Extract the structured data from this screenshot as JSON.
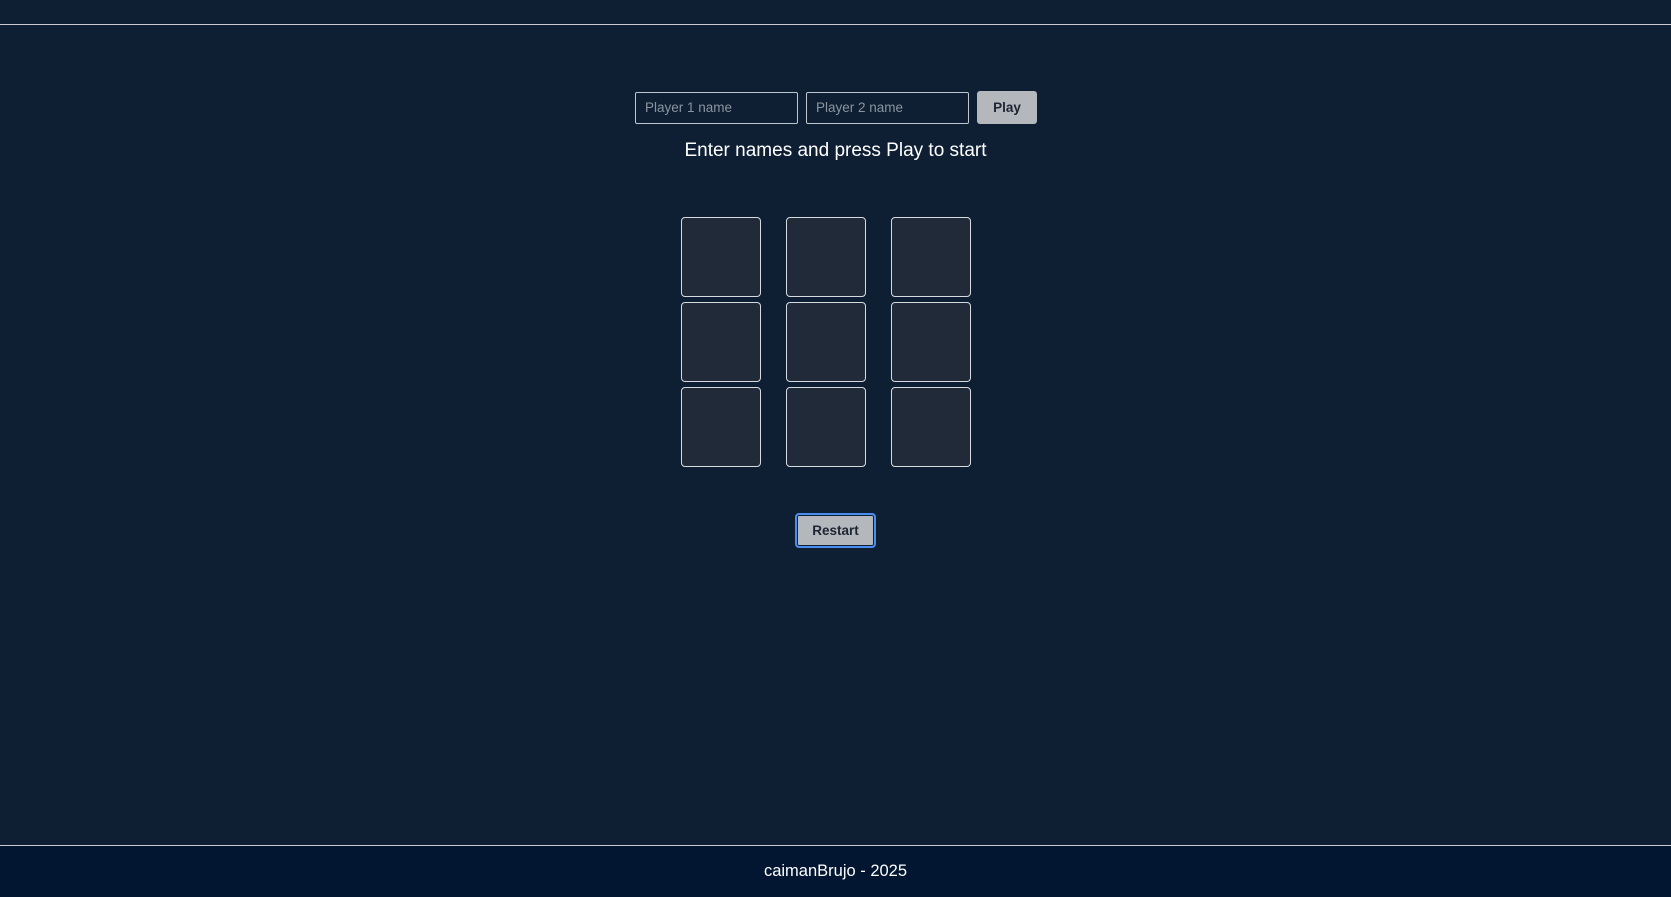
{
  "inputs": {
    "player1": {
      "placeholder": "Player 1 name",
      "value": ""
    },
    "player2": {
      "placeholder": "Player 2 name",
      "value": ""
    }
  },
  "buttons": {
    "play_label": "Play",
    "restart_label": "Restart"
  },
  "status_text": "Enter names and press Play to start",
  "board": {
    "cells": [
      "",
      "",
      "",
      "",
      "",
      "",
      "",
      "",
      ""
    ]
  },
  "footer": {
    "text": "caimanBrujo - 2025"
  },
  "colors": {
    "background": "#0e1f33",
    "cell_background": "#212a38",
    "footer_background": "#021631",
    "button_background": "#b4b7bc",
    "focus_ring": "#4a8df0"
  }
}
